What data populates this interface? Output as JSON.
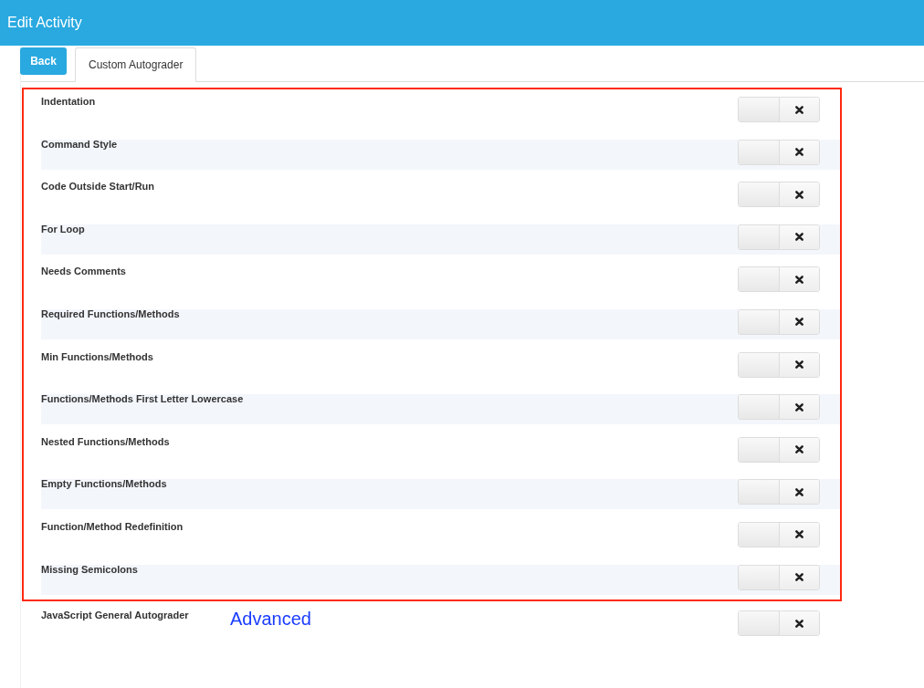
{
  "header": {
    "title": "Edit Activity"
  },
  "back_button": {
    "label": "Back"
  },
  "tabs": [
    {
      "label": "Custom Autograder",
      "selected": true
    }
  ],
  "rules": [
    {
      "label": "Indentation",
      "on": false
    },
    {
      "label": "Command Style",
      "on": false
    },
    {
      "label": "Code Outside Start/Run",
      "on": false
    },
    {
      "label": "For Loop",
      "on": false
    },
    {
      "label": "Needs Comments",
      "on": false
    },
    {
      "label": "Required Functions/Methods",
      "on": false
    },
    {
      "label": "Min Functions/Methods",
      "on": false
    },
    {
      "label": "Functions/Methods First Letter Lowercase",
      "on": false
    },
    {
      "label": "Nested Functions/Methods",
      "on": false
    },
    {
      "label": "Empty Functions/Methods",
      "on": false
    },
    {
      "label": "Function/Method Redefinition",
      "on": false
    },
    {
      "label": "Missing Semicolons",
      "on": false
    }
  ],
  "general": {
    "label": "JavaScript General Autograder",
    "link": "Advanced",
    "on": false
  }
}
